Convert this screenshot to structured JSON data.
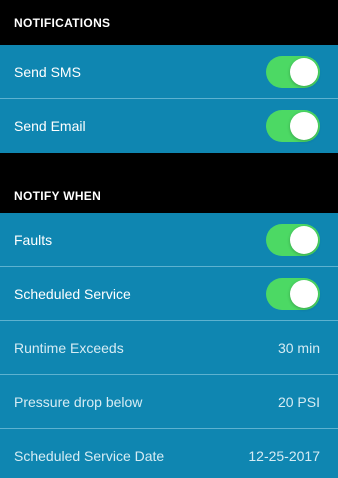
{
  "colors": {
    "header_bg": "#000000",
    "row_bg": "#0F86B1",
    "divider": "#5DB2D0",
    "toggle_on": "#4CD964",
    "text": "#FFFFFF"
  },
  "notifications": {
    "header": "NOTIFICATIONS",
    "items": [
      {
        "label": "Send SMS",
        "toggle_on": true
      },
      {
        "label": "Send Email",
        "toggle_on": true
      }
    ]
  },
  "notify_when": {
    "header": "NOTIFY WHEN",
    "toggles": [
      {
        "label": "Faults",
        "toggle_on": true
      },
      {
        "label": "Scheduled Service",
        "toggle_on": true
      }
    ],
    "values": [
      {
        "label": "Runtime Exceeds",
        "value": "30 min"
      },
      {
        "label": "Pressure drop below",
        "value": "20 PSI"
      },
      {
        "label": "Scheduled Service Date",
        "value": "12-25-2017"
      }
    ]
  }
}
